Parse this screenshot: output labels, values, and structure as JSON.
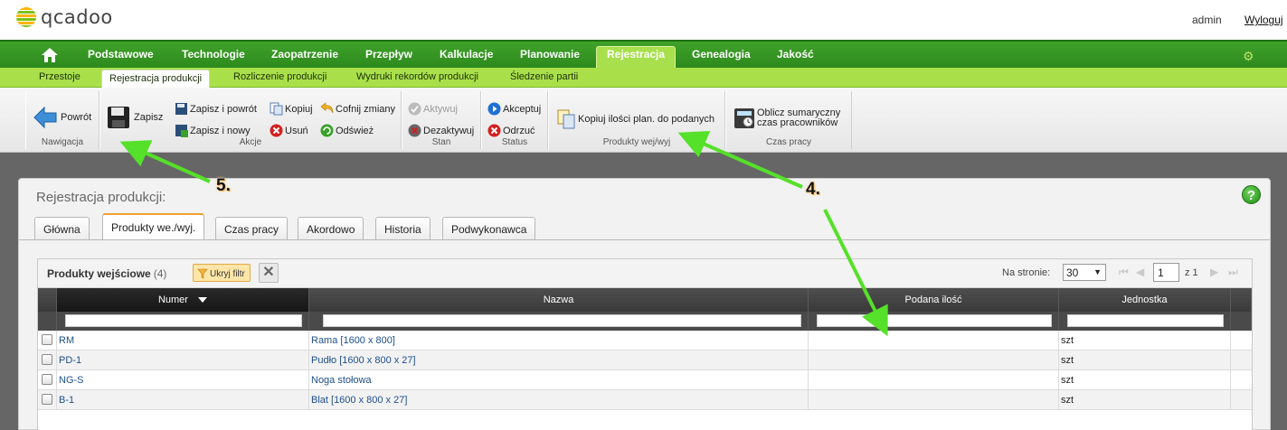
{
  "app": {
    "logo_text": "qcadoo",
    "user": "admin",
    "logout": "Wyloguj"
  },
  "menu": {
    "items": [
      "Podstawowe",
      "Technologie",
      "Zaopatrzenie",
      "Przepływ",
      "Kalkulacje",
      "Planowanie",
      "Rejestracja",
      "Genealogia",
      "Jakość"
    ],
    "active": "Rejestracja"
  },
  "submenu": {
    "items": [
      "Przestoje",
      "Rejestracja produkcji",
      "Rozliczenie produkcji",
      "Wydruki rekordów produkcji",
      "Śledzenie partii"
    ],
    "active": "Rejestracja produkcji"
  },
  "ribbon": {
    "groups": {
      "nav": "Nawigacja",
      "actions": "Akcje",
      "state": "Stan",
      "status": "Status",
      "products": "Produkty wej/wyj",
      "worktime": "Czas pracy"
    },
    "back": "Powrót",
    "save": "Zapisz",
    "save_back": "Zapisz i powrót",
    "save_new": "Zapisz i nowy",
    "copy": "Kopiuj",
    "delete": "Usuń",
    "undo": "Cofnij zmiany",
    "refresh": "Odśwież",
    "activate": "Aktywuj",
    "deactivate": "Dezaktywuj",
    "accept": "Akceptuj",
    "reject": "Odrzuć",
    "copy_quantities": "Kopiuj ilości plan. do podanych",
    "calc_line1": "Oblicz sumaryczny",
    "calc_line2": "czas pracowników"
  },
  "panel": {
    "title": "Rejestracja produkcji:",
    "tabs": [
      "Główna",
      "Produkty we./wyj.",
      "Czas pracy",
      "Akordowo",
      "Historia",
      "Podwykonawca"
    ],
    "active_tab": "Produkty we./wyj."
  },
  "grid": {
    "title": "Produkty wejściowe",
    "count": "(4)",
    "hide_filter": "Ukryj filtr",
    "per_page_label": "Na stronie:",
    "per_page": "30",
    "page": "1",
    "of": "z 1",
    "columns": [
      "Numer",
      "Nazwa",
      "Podana ilość",
      "Jednostka"
    ],
    "rows": [
      {
        "number": "RM",
        "name": "Rama [1600 x 800]",
        "qty": "",
        "unit": "szt"
      },
      {
        "number": "PD-1",
        "name": "Pudło [1600 x 800 x 27]",
        "qty": "",
        "unit": "szt"
      },
      {
        "number": "NG-S",
        "name": "Noga stołowa",
        "qty": "",
        "unit": "szt"
      },
      {
        "number": "B-1",
        "name": "Blat [1600 x 800 x 27]",
        "qty": "",
        "unit": "szt"
      }
    ]
  },
  "annotations": {
    "callout_5": "5.",
    "callout_4": "4."
  },
  "colors": {
    "menu_green": "#2d8a1d",
    "submenu_green": "#a9e04a",
    "arrow_green": "#55e02a",
    "link": "#1e4f8a"
  },
  "icons": [
    "home-icon",
    "gear-icon",
    "back-arrow-icon",
    "floppy-icon",
    "save-back-icon",
    "save-new-icon",
    "copy-icon",
    "delete-icon",
    "undo-icon",
    "refresh-icon",
    "activate-icon",
    "deactivate-icon",
    "accept-icon",
    "reject-icon",
    "copy-quantities-icon",
    "calculator-icon",
    "help-icon",
    "filter-icon",
    "clear-filter-icon",
    "sort-down-icon"
  ]
}
